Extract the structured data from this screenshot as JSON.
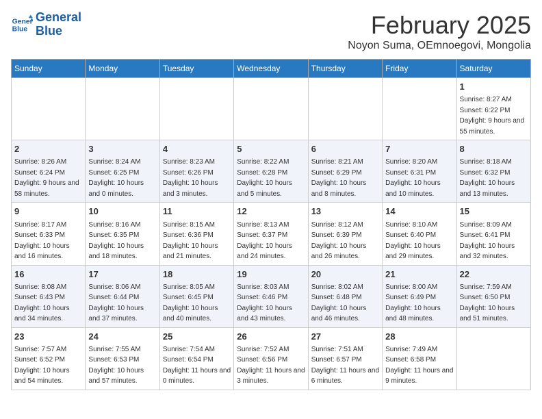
{
  "header": {
    "logo_line1": "General",
    "logo_line2": "Blue",
    "month_title": "February 2025",
    "subtitle": "Noyon Suma, OEmnoegovi, Mongolia"
  },
  "days_of_week": [
    "Sunday",
    "Monday",
    "Tuesday",
    "Wednesday",
    "Thursday",
    "Friday",
    "Saturday"
  ],
  "weeks": [
    [
      {
        "day": "",
        "info": ""
      },
      {
        "day": "",
        "info": ""
      },
      {
        "day": "",
        "info": ""
      },
      {
        "day": "",
        "info": ""
      },
      {
        "day": "",
        "info": ""
      },
      {
        "day": "",
        "info": ""
      },
      {
        "day": "1",
        "info": "Sunrise: 8:27 AM\nSunset: 6:22 PM\nDaylight: 9 hours and 55 minutes."
      }
    ],
    [
      {
        "day": "2",
        "info": "Sunrise: 8:26 AM\nSunset: 6:24 PM\nDaylight: 9 hours and 58 minutes."
      },
      {
        "day": "3",
        "info": "Sunrise: 8:24 AM\nSunset: 6:25 PM\nDaylight: 10 hours and 0 minutes."
      },
      {
        "day": "4",
        "info": "Sunrise: 8:23 AM\nSunset: 6:26 PM\nDaylight: 10 hours and 3 minutes."
      },
      {
        "day": "5",
        "info": "Sunrise: 8:22 AM\nSunset: 6:28 PM\nDaylight: 10 hours and 5 minutes."
      },
      {
        "day": "6",
        "info": "Sunrise: 8:21 AM\nSunset: 6:29 PM\nDaylight: 10 hours and 8 minutes."
      },
      {
        "day": "7",
        "info": "Sunrise: 8:20 AM\nSunset: 6:31 PM\nDaylight: 10 hours and 10 minutes."
      },
      {
        "day": "8",
        "info": "Sunrise: 8:18 AM\nSunset: 6:32 PM\nDaylight: 10 hours and 13 minutes."
      }
    ],
    [
      {
        "day": "9",
        "info": "Sunrise: 8:17 AM\nSunset: 6:33 PM\nDaylight: 10 hours and 16 minutes."
      },
      {
        "day": "10",
        "info": "Sunrise: 8:16 AM\nSunset: 6:35 PM\nDaylight: 10 hours and 18 minutes."
      },
      {
        "day": "11",
        "info": "Sunrise: 8:15 AM\nSunset: 6:36 PM\nDaylight: 10 hours and 21 minutes."
      },
      {
        "day": "12",
        "info": "Sunrise: 8:13 AM\nSunset: 6:37 PM\nDaylight: 10 hours and 24 minutes."
      },
      {
        "day": "13",
        "info": "Sunrise: 8:12 AM\nSunset: 6:39 PM\nDaylight: 10 hours and 26 minutes."
      },
      {
        "day": "14",
        "info": "Sunrise: 8:10 AM\nSunset: 6:40 PM\nDaylight: 10 hours and 29 minutes."
      },
      {
        "day": "15",
        "info": "Sunrise: 8:09 AM\nSunset: 6:41 PM\nDaylight: 10 hours and 32 minutes."
      }
    ],
    [
      {
        "day": "16",
        "info": "Sunrise: 8:08 AM\nSunset: 6:43 PM\nDaylight: 10 hours and 34 minutes."
      },
      {
        "day": "17",
        "info": "Sunrise: 8:06 AM\nSunset: 6:44 PM\nDaylight: 10 hours and 37 minutes."
      },
      {
        "day": "18",
        "info": "Sunrise: 8:05 AM\nSunset: 6:45 PM\nDaylight: 10 hours and 40 minutes."
      },
      {
        "day": "19",
        "info": "Sunrise: 8:03 AM\nSunset: 6:46 PM\nDaylight: 10 hours and 43 minutes."
      },
      {
        "day": "20",
        "info": "Sunrise: 8:02 AM\nSunset: 6:48 PM\nDaylight: 10 hours and 46 minutes."
      },
      {
        "day": "21",
        "info": "Sunrise: 8:00 AM\nSunset: 6:49 PM\nDaylight: 10 hours and 48 minutes."
      },
      {
        "day": "22",
        "info": "Sunrise: 7:59 AM\nSunset: 6:50 PM\nDaylight: 10 hours and 51 minutes."
      }
    ],
    [
      {
        "day": "23",
        "info": "Sunrise: 7:57 AM\nSunset: 6:52 PM\nDaylight: 10 hours and 54 minutes."
      },
      {
        "day": "24",
        "info": "Sunrise: 7:55 AM\nSunset: 6:53 PM\nDaylight: 10 hours and 57 minutes."
      },
      {
        "day": "25",
        "info": "Sunrise: 7:54 AM\nSunset: 6:54 PM\nDaylight: 11 hours and 0 minutes."
      },
      {
        "day": "26",
        "info": "Sunrise: 7:52 AM\nSunset: 6:56 PM\nDaylight: 11 hours and 3 minutes."
      },
      {
        "day": "27",
        "info": "Sunrise: 7:51 AM\nSunset: 6:57 PM\nDaylight: 11 hours and 6 minutes."
      },
      {
        "day": "28",
        "info": "Sunrise: 7:49 AM\nSunset: 6:58 PM\nDaylight: 11 hours and 9 minutes."
      },
      {
        "day": "",
        "info": ""
      }
    ]
  ]
}
